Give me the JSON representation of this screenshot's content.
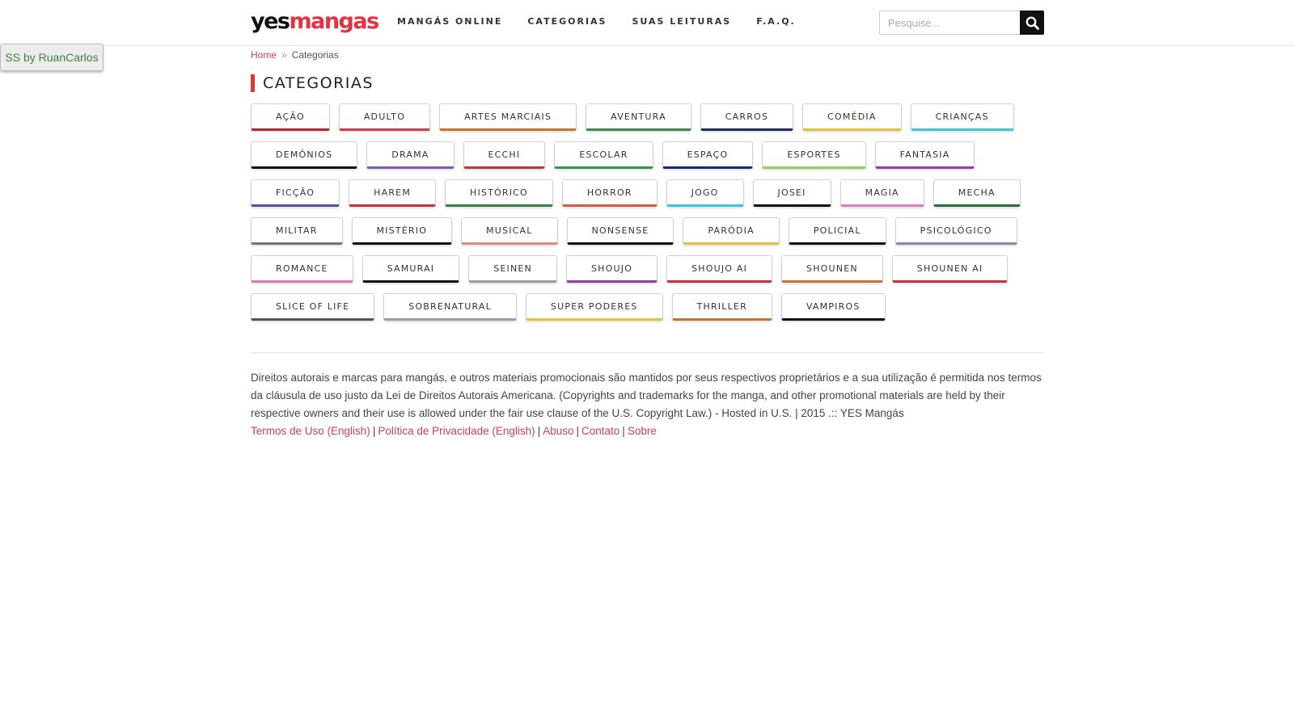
{
  "header": {
    "logo": {
      "part1": "yes",
      "part2": "mangas"
    },
    "nav": [
      "MANGÁS ONLINE",
      "CATEGORIAS",
      "SUAS LEITURAS",
      "F.A.Q."
    ],
    "search": {
      "placeholder": "Pesquise...",
      "value": "",
      "icon": "search-icon"
    }
  },
  "badge": "SS by RuanCarlos",
  "breadcrumb": {
    "home": "Home",
    "separator": "»",
    "current": "Categorias"
  },
  "page_title": "CATEGORIAS",
  "categories": [
    {
      "label": "AÇÃO",
      "color": "#b8262e"
    },
    {
      "label": "ADULTO",
      "color": "#d23a4e"
    },
    {
      "label": "ARTES MARCIAIS",
      "color": "#c9742a"
    },
    {
      "label": "AVENTURA",
      "color": "#3e8a4a"
    },
    {
      "label": "CARROS",
      "color": "#1a2a5a"
    },
    {
      "label": "COMÉDIA",
      "color": "#e8c13a"
    },
    {
      "label": "CRIANÇAS",
      "color": "#3fc6d8"
    },
    {
      "label": "DEMÔNIOS",
      "color": "#111111"
    },
    {
      "label": "DRAMA",
      "color": "#7e5cb8"
    },
    {
      "label": "ECCHI",
      "color": "#c9333f"
    },
    {
      "label": "ESCOLAR",
      "color": "#2f9a4a"
    },
    {
      "label": "ESPAÇO",
      "color": "#1a2a7a"
    },
    {
      "label": "ESPORTES",
      "color": "#9acb5a"
    },
    {
      "label": "FANTASIA",
      "color": "#9a3aa8"
    },
    {
      "label": "FICÇÃO",
      "color": "#5a4a9a"
    },
    {
      "label": "HAREM",
      "color": "#c9333f"
    },
    {
      "label": "HISTÓRICO",
      "color": "#3e7a4a"
    },
    {
      "label": "HORROR",
      "color": "#d65a4a"
    },
    {
      "label": "JOGO",
      "color": "#3fc6d8"
    },
    {
      "label": "JOSEI",
      "color": "#111111"
    },
    {
      "label": "MAGIA",
      "color": "#d680c8"
    },
    {
      "label": "MECHA",
      "color": "#2f6a3a"
    },
    {
      "label": "MILITAR",
      "color": "#777777"
    },
    {
      "label": "MISTÉRIO",
      "color": "#111111"
    },
    {
      "label": "MUSICAL",
      "color": "#e08a7a"
    },
    {
      "label": "NONSENSE",
      "color": "#111111"
    },
    {
      "label": "PARÓDIA",
      "color": "#e8c13a"
    },
    {
      "label": "POLICIAL",
      "color": "#111111"
    },
    {
      "label": "PSICOLÓGICO",
      "color": "#8a8aa8"
    },
    {
      "label": "ROMANCE",
      "color": "#d67ab8"
    },
    {
      "label": "SAMURAI",
      "color": "#111111"
    },
    {
      "label": "SEINEN",
      "color": "#9a9aaa"
    },
    {
      "label": "SHOUJO",
      "color": "#9a3aa8"
    },
    {
      "label": "SHOUJO AI",
      "color": "#c9333f"
    },
    {
      "label": "SHOUNEN",
      "color": "#c9742a"
    },
    {
      "label": "SHOUNEN AI",
      "color": "#c9333f"
    },
    {
      "label": "SLICE OF LIFE",
      "color": "#555555"
    },
    {
      "label": "SOBRENATURAL",
      "color": "#9a9aaa"
    },
    {
      "label": "SUPER PODERES",
      "color": "#e8c13a"
    },
    {
      "label": "THRILLER",
      "color": "#c9742a"
    },
    {
      "label": "VAMPIROS",
      "color": "#111111"
    }
  ],
  "footer": {
    "text": "Direitos autorais e marcas para mangás, e outros materiais promocionais são mantidos por seus respectivos proprietários e a sua utilização é permitida nos termos da cláusula de uso justo da Lei de Direitos Autorais Americana. (Copyrights and trademarks for the manga, and other promotional materials are held by their respective owners and their use is allowed under the fair use clause of the U.S. Copyright Law.) - Hosted in U.S. | 2015 .:: YES Mangás",
    "links": [
      "Termos de Uso (English)",
      "Política de Privacidade (English)",
      "Abuso",
      "Contato",
      "Sobre"
    ],
    "link_separator": "|"
  },
  "colors": {
    "accent": "#e4323f",
    "link": "#c9434c",
    "search_button": "#111111"
  }
}
